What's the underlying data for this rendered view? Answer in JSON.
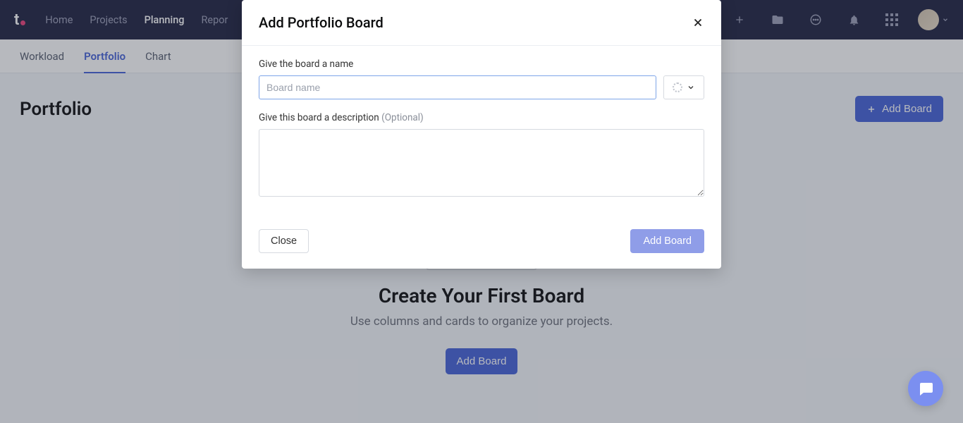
{
  "topnav": {
    "items": [
      "Home",
      "Projects",
      "Planning",
      "Repor"
    ],
    "activeIndex": 2
  },
  "subnav": {
    "items": [
      "Workload",
      "Portfolio",
      "Chart"
    ],
    "activeIndex": 1
  },
  "page": {
    "title": "Portfolio",
    "addBoardBtn": "Add Board"
  },
  "empty": {
    "title": "Create Your First Board",
    "subtitle": "Use columns and cards to organize your projects.",
    "cta": "Add Board"
  },
  "modal": {
    "title": "Add Portfolio Board",
    "nameLabel": "Give the board a name",
    "namePlaceholder": "Board name",
    "descLabel": "Give this board a description ",
    "descOptional": "(Optional)",
    "closeBtn": "Close",
    "submitBtn": "Add Board"
  }
}
